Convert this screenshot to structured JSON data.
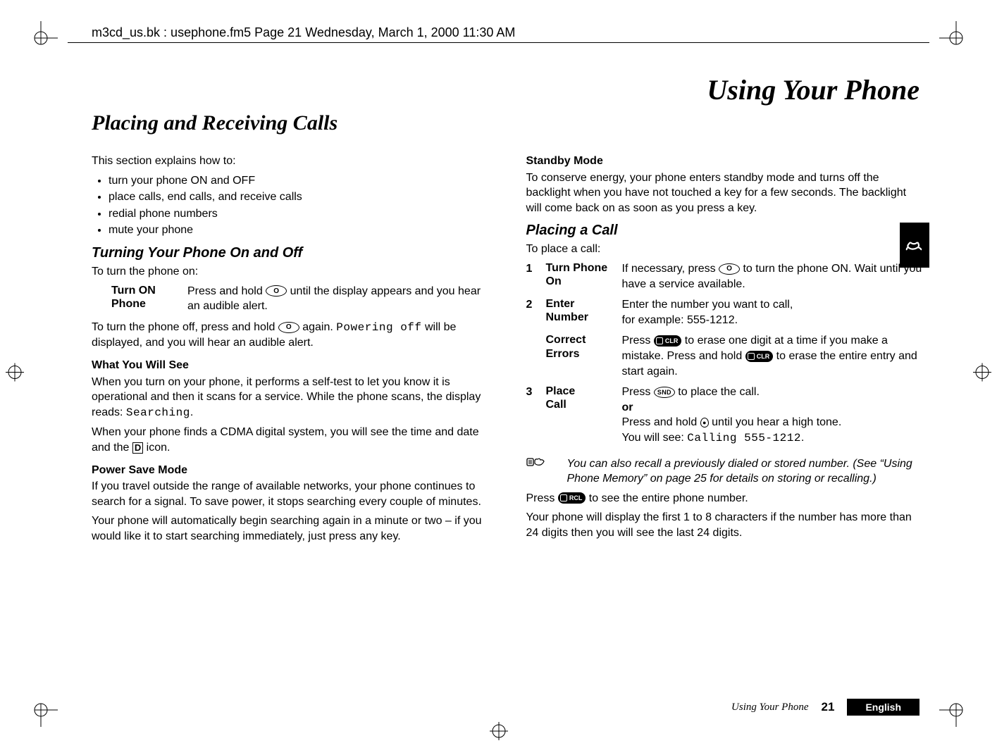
{
  "slug": "m3cd_us.bk : usephone.fm5  Page 21  Wednesday, March 1, 2000  11:30 AM",
  "doc_title": "Using Your Phone",
  "section_title": "Placing and Receiving Calls",
  "left": {
    "intro": "This section explains how to:",
    "bullets": [
      "turn your phone ON and OFF",
      "place calls, end calls, and receive calls",
      "redial phone numbers",
      "mute your phone"
    ],
    "h_turning": "Turning Your Phone On and Off",
    "turn_on_intro": "To turn the phone on:",
    "turn_on_label_1": "Turn ON",
    "turn_on_label_2": "Phone",
    "turn_on_desc_1": "Press and hold ",
    "turn_on_desc_2": " until the display appears and you hear an audible alert.",
    "turn_off_1": "To turn the phone off, press and hold ",
    "turn_off_2": " again. ",
    "turn_off_code": "Powering off",
    "turn_off_3": " will be displayed, and you will hear an audible alert.",
    "h_what": "What You Will See",
    "what_p1": "When you turn on your phone, it performs a self-test to let you know it is operational and then it scans for a service. While the phone scans, the display reads: ",
    "what_p1_code": "Searching",
    "what_p1_end": ".",
    "what_p2_1": "When your phone finds a CDMA digital system, you will see the time and date and the ",
    "what_p2_2": " icon.",
    "h_psm": "Power Save Mode",
    "psm_p1": "If you travel outside the range of available networks, your phone continues to search for a signal. To save power, it stops searching every couple of minutes.",
    "psm_p2": "Your phone will automatically begin searching again in a minute or two – if you would like it to start searching immediately, just press any key."
  },
  "right": {
    "h_standby": "Standby Mode",
    "standby_p": "To conserve energy, your phone enters standby mode and turns off the backlight when you have not touched a key for a few seconds. The backlight will come back on as soon as you press a key.",
    "h_placing": "Placing a Call",
    "placing_intro": "To place a call:",
    "steps": [
      {
        "num": "1",
        "label1": "Turn Phone",
        "label2": "On",
        "text_a": "If necessary, press ",
        "text_b": " to turn the phone ON. Wait until you have a service available."
      },
      {
        "num": "2",
        "label1": "Enter",
        "label2": "Number",
        "text": "Enter the number you want to call,\nfor example: 555-1212."
      },
      {
        "num": "",
        "label1": "Correct",
        "label2": "Errors",
        "text_a": "Press ",
        "text_b": " to erase one digit at a time if you make a mistake. Press and hold ",
        "text_c": " to erase the entire entry and start again."
      },
      {
        "num": "3",
        "label1": "Place",
        "label2": "Call",
        "text_a": "Press ",
        "text_b": " to place the call.",
        "or": "or",
        "text_c": "Press and hold ",
        "text_d": " until you hear a high tone.",
        "see": "You will see: ",
        "see_code": "Calling 555-1212",
        "see_end": "."
      }
    ],
    "note_text": "You can also recall a previously dialed or stored number. (See “Using Phone Memory” on page 25 for details on storing or recalling.)",
    "see_entire_a": "Press ",
    "see_entire_b": " to see the entire phone number.",
    "last_p": "Your phone will display the first 1 to 8 characters if the number has more than 24 digits then you will see the last 24 digits."
  },
  "footer": {
    "section": "Using Your Phone",
    "page": "21",
    "lang": "English"
  },
  "icons": {
    "power": "O",
    "snd": "SND",
    "clr": "CLR",
    "rcl": "RCL",
    "d": "D"
  }
}
